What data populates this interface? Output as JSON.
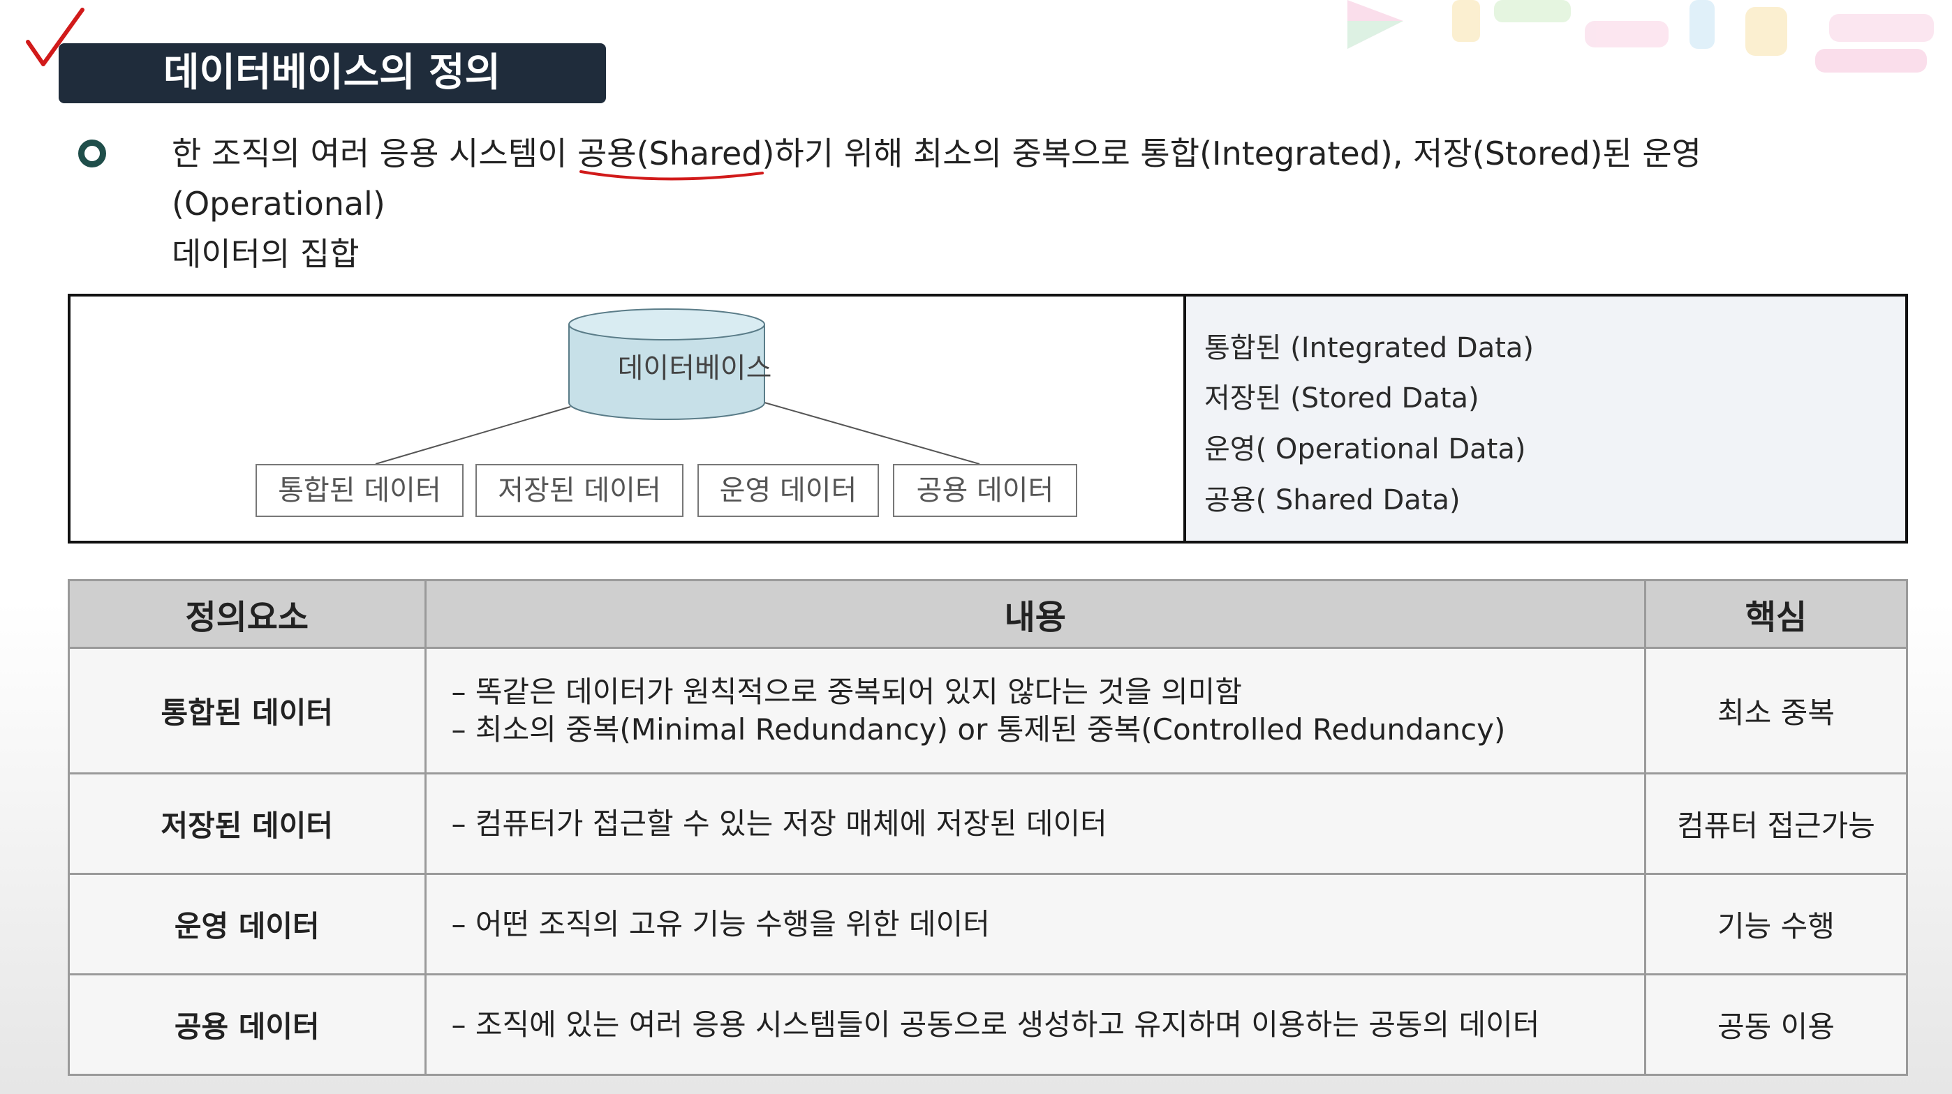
{
  "title": "데이터베이스의 정의",
  "definition": {
    "lines": [
      "한 조직의 여러 응용 시스템이 공용(Shared)하기 위해 최소의 중복으로 통합(Integrated), 저장(Stored)된 운영(Operational)",
      "데이터의 집합"
    ]
  },
  "diagram": {
    "root": "데이터베이스",
    "children": [
      "통합된 데이터",
      "저장된 데이터",
      "운영 데이터",
      "공용 데이터"
    ],
    "legend": [
      "통합된 (Integrated Data)",
      "저장된 (Stored Data)",
      "운영( Operational Data)",
      "공용( Shared Data)"
    ]
  },
  "table": {
    "headers": [
      "정의요소",
      "내용",
      "핵심"
    ],
    "rows": [
      {
        "element": "통합된 데이터",
        "content": [
          "–  똑같은 데이터가 원칙적으로 중복되어 있지 않다는 것을 의미함",
          "–  최소의 중복(Minimal Redundancy) or 통제된 중복(Controlled Redundancy)"
        ],
        "core": "최소 중복"
      },
      {
        "element": "저장된 데이터",
        "content": [
          "– 컴퓨터가 접근할 수 있는 저장 매체에 저장된 데이터"
        ],
        "core": "컴퓨터 접근가능"
      },
      {
        "element": "운영 데이터",
        "content": [
          "– 어떤 조직의 고유 기능 수행을 위한 데이터"
        ],
        "core": "기능 수행"
      },
      {
        "element": "공용 데이터",
        "content": [
          "– 조직에 있는 여러 응용 시스템들이 공동으로 생성하고 유지하며 이용하는 공동의 데이터"
        ],
        "core": "공동 이용"
      }
    ]
  },
  "colors": {
    "banner": "#1f2c3b",
    "bullet": "#1f4e4a",
    "annotation": "#d11a1a",
    "cylinder": "#c7e0e8",
    "table_header": "#cfcfcf"
  },
  "icons": [
    "checkmark-icon",
    "bullet-ring-icon",
    "database-cylinder-icon",
    "brand-logo-watermark"
  ]
}
